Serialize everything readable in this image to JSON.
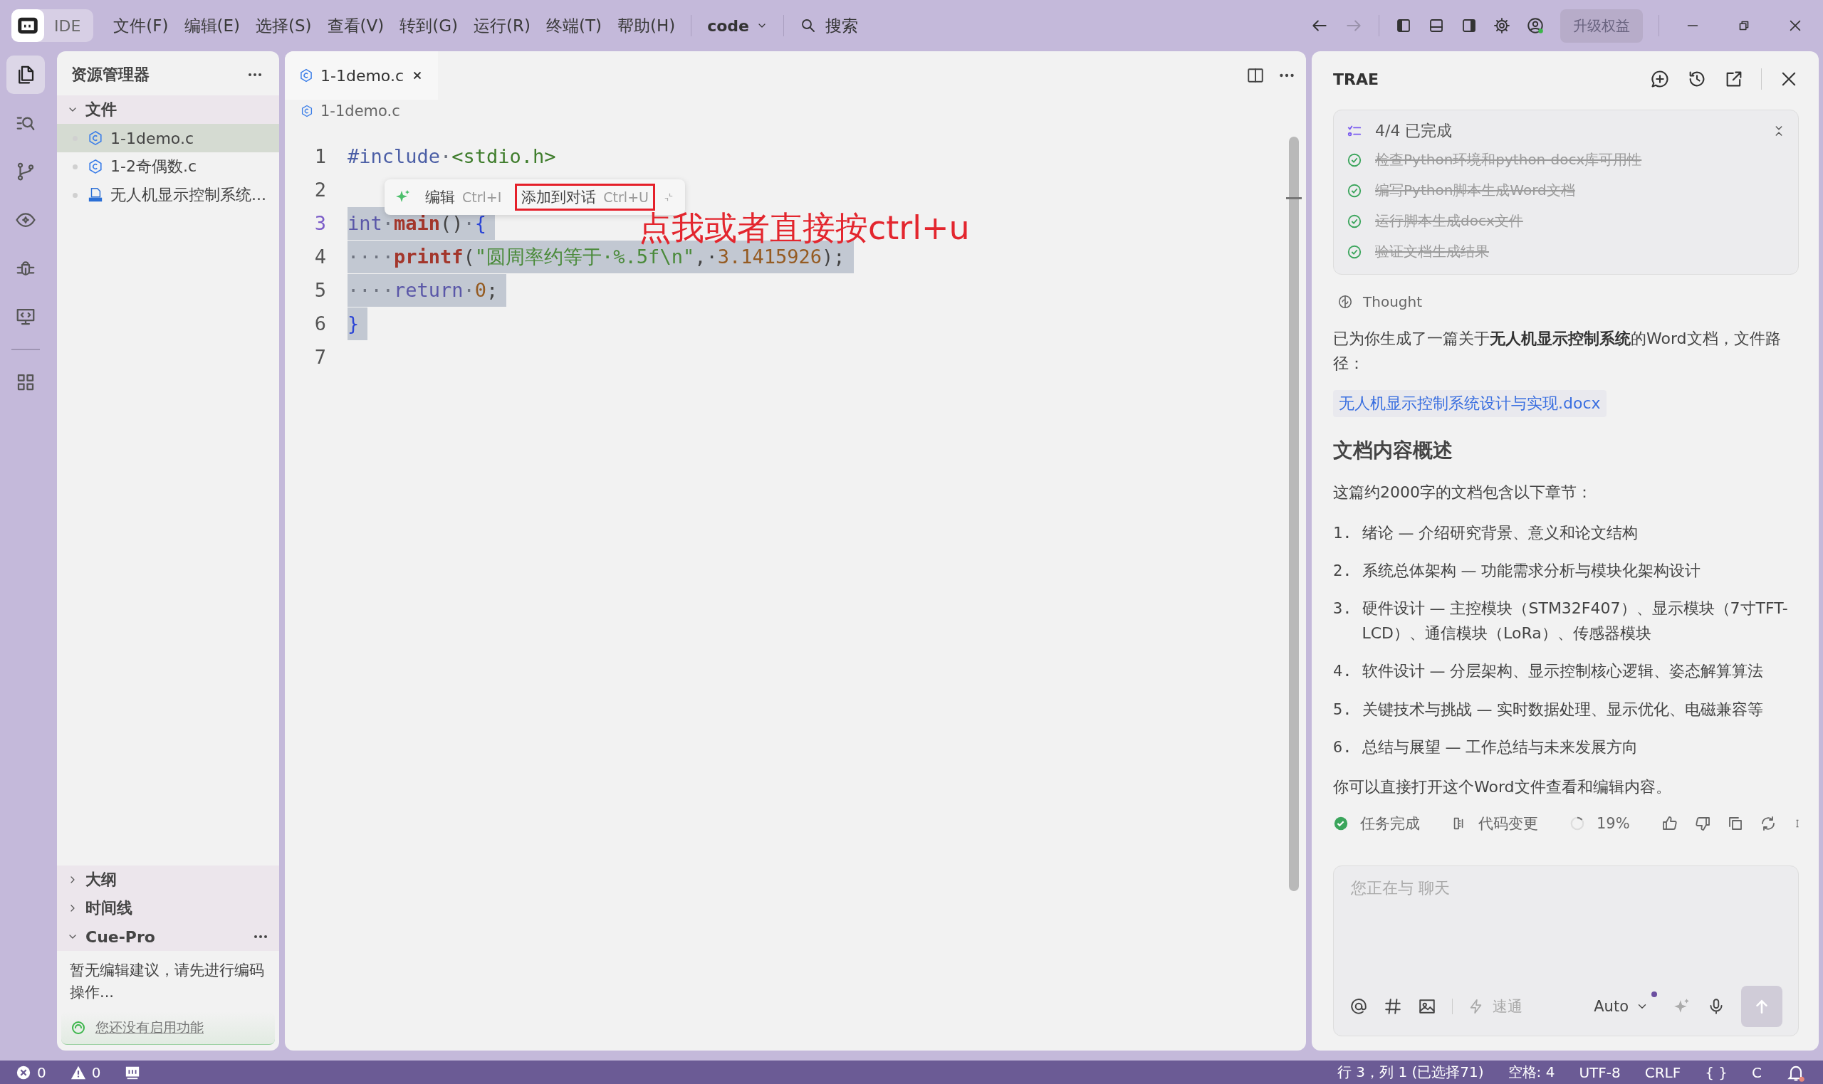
{
  "titlebar": {
    "logo_label": "IDE",
    "menus": [
      "文件(F)",
      "编辑(E)",
      "选择(S)",
      "查看(V)",
      "转到(G)",
      "运行(R)",
      "终端(T)",
      "帮助(H)"
    ],
    "project": "code",
    "search": "搜索",
    "nav": [
      {
        "kind": "back",
        "disabled": false
      },
      {
        "kind": "forward",
        "disabled": true
      }
    ],
    "upgrade": "升级权益"
  },
  "activity_bar": [
    {
      "kind": "files",
      "selected": true
    },
    {
      "kind": "search",
      "selected": false
    },
    {
      "kind": "branch",
      "selected": false
    },
    {
      "kind": "eye",
      "selected": false
    },
    {
      "kind": "bug",
      "selected": false
    },
    {
      "kind": "remote",
      "selected": false
    },
    {
      "kind": "grid",
      "selected": false
    }
  ],
  "explorer": {
    "title": "资源管理器",
    "section": {
      "label": "文件",
      "expanded": true
    },
    "files": [
      {
        "name": "1-1demo.c",
        "kind": "c",
        "selected": true
      },
      {
        "name": "1-2奇偶数.c",
        "kind": "c",
        "selected": false
      },
      {
        "name": "无人机显示控制系统...",
        "kind": "docx",
        "selected": false
      }
    ],
    "bottom_sections": [
      {
        "label": "大纲",
        "expanded": false,
        "more": false
      },
      {
        "label": "时间线",
        "expanded": false,
        "more": false
      },
      {
        "label": "Cue-Pro",
        "expanded": true,
        "more": true
      }
    ],
    "cue_message": "暂无编辑建议，请先进行编码操作...",
    "cue_link": "您还没有启用功能"
  },
  "editor": {
    "tabs": [
      {
        "label": "1-1demo.c",
        "selected": true
      }
    ],
    "breadcrumb": "1-1demo.c",
    "lines": [
      {
        "number": "1",
        "current": false,
        "selected": false,
        "tokens": [
          {
            "text": "#include",
            "kind": "pp"
          },
          {
            "text": "·",
            "kind": "ws"
          },
          {
            "text": "<stdio.h>",
            "kind": "hdr"
          }
        ]
      },
      {
        "number": "2",
        "current": false,
        "selected": false
      },
      {
        "number": "3",
        "current": true,
        "selected": true,
        "tokens": [
          {
            "text": "int",
            "kind": "kw"
          },
          {
            "text": "·",
            "kind": "ws"
          },
          {
            "text": "main",
            "kind": "fn"
          },
          {
            "text": "()",
            "kind": "punc"
          },
          {
            "text": "·",
            "kind": "ws"
          },
          {
            "text": "{",
            "kind": "brace"
          }
        ]
      },
      {
        "number": "4",
        "current": false,
        "selected": true,
        "tokens": [
          {
            "text": "····",
            "kind": "ws"
          },
          {
            "text": "printf",
            "kind": "fn"
          },
          {
            "text": "(",
            "kind": "punc"
          },
          {
            "text": "\"圆周率约等于·%.5f\\n\"",
            "kind": "str"
          },
          {
            "text": ",·",
            "kind": "punc"
          },
          {
            "text": "3.1415926",
            "kind": "num"
          },
          {
            "text": ");",
            "kind": "punc"
          }
        ]
      },
      {
        "number": "5",
        "current": false,
        "selected": true,
        "tokens": [
          {
            "text": "····",
            "kind": "ws"
          },
          {
            "text": "return",
            "kind": "kw"
          },
          {
            "text": "·",
            "kind": "ws"
          },
          {
            "text": "0",
            "kind": "num"
          },
          {
            "text": ";",
            "kind": "punc"
          }
        ]
      },
      {
        "number": "6",
        "current": false,
        "selected": true,
        "tokens": [
          {
            "text": "}",
            "kind": "brace"
          }
        ]
      },
      {
        "number": "7",
        "current": false,
        "selected": false
      }
    ],
    "popup": {
      "actions": [
        {
          "label": "编辑",
          "shortcut": "Ctrl+I",
          "highlighted": false
        },
        {
          "label": "添加到对话",
          "shortcut": "Ctrl+U",
          "highlighted": true
        }
      ]
    },
    "annotation": "点我或者直接按ctrl+u"
  },
  "assistant": {
    "title": "TRAE",
    "tasks": {
      "summary": "4/4 已完成",
      "items": [
        {
          "label": "检查Python环境和python-docx库可用性",
          "done": true
        },
        {
          "label": "编写Python脚本生成Word文档",
          "done": true
        },
        {
          "label": "运行脚本生成docx文件",
          "done": true
        },
        {
          "label": "验证文档生成结果",
          "done": true
        }
      ]
    },
    "thought": "Thought",
    "message": "已为你生成了一篇关于**无人机显示控制系统**的Word文档，文件路径：",
    "file_link": "无人机显示控制系统设计与实现.docx",
    "heading": "文档内容概述",
    "intro": "这篇约2000字的文档包含以下章节：",
    "list": [
      {
        "marker": "1.",
        "text": "绪论 — 介绍研究背景、意义和论文结构"
      },
      {
        "marker": "2.",
        "text": "系统总体架构 — 功能需求分析与模块化架构设计"
      },
      {
        "marker": "3.",
        "text": "硬件设计 — 主控模块（STM32F407）、显示模块（7寸TFT-LCD）、通信模块（LoRa）、传感器模块"
      },
      {
        "marker": "4.",
        "text": "软件设计 — 分层架构、显示控制核心逻辑、姿态解算算法"
      },
      {
        "marker": "5.",
        "text": "关键技术与挑战 — 实时数据处理、显示优化、电磁兼容等"
      },
      {
        "marker": "6.",
        "text": "总结与展望 — 工作总结与未来发展方向"
      }
    ],
    "closing": "你可以直接打开这个Word文件查看和编辑内容。",
    "status": "任务完成",
    "changes": "代码变更",
    "progress": "19%",
    "input": {
      "placeholder": "您正在与 聊天",
      "mode": "速通",
      "model": "Auto"
    }
  },
  "status_bar": {
    "errors": "0",
    "warnings": "0",
    "position": "行 3，列 1 (已选择71)",
    "indent": "空格: 4",
    "encoding": "UTF-8",
    "eol": "CRLF",
    "braces": "{ }",
    "language": "C"
  }
}
